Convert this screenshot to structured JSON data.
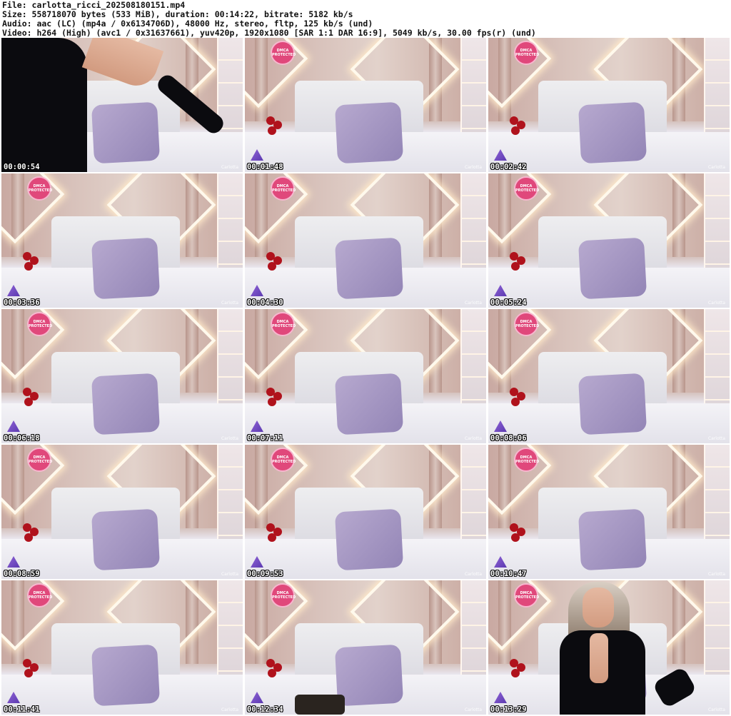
{
  "header": {
    "line1": "File: carlotta_ricci_202508180151.mp4",
    "line2": "Size: 558718070 bytes (533 MiB), duration: 00:14:22, bitrate: 5182 kb/s",
    "line3": "Audio: aac (LC) (mp4a / 0x6134706D), 48000 Hz, stereo, fltp, 125 kb/s (und)",
    "line4": "Video: h264 (High) (avc1 / 0x31637661), yuv420p, 1920x1080 [SAR 1:1 DAR 16:9], 5049 kb/s, 30.00 fps(r) (und)"
  },
  "thumbnails": [
    {
      "timestamp": "00:00:54",
      "scene": "dark-figure-left"
    },
    {
      "timestamp": "00:01:48",
      "scene": "empty-bed"
    },
    {
      "timestamp": "00:02:42",
      "scene": "empty-bed"
    },
    {
      "timestamp": "00:03:36",
      "scene": "empty-bed"
    },
    {
      "timestamp": "00:04:30",
      "scene": "empty-bed"
    },
    {
      "timestamp": "00:05:24",
      "scene": "empty-bed"
    },
    {
      "timestamp": "00:06:18",
      "scene": "empty-bed"
    },
    {
      "timestamp": "00:07:11",
      "scene": "empty-bed"
    },
    {
      "timestamp": "00:08:06",
      "scene": "empty-bed"
    },
    {
      "timestamp": "00:08:59",
      "scene": "empty-bed"
    },
    {
      "timestamp": "00:09:53",
      "scene": "empty-bed"
    },
    {
      "timestamp": "00:10:47",
      "scene": "empty-bed"
    },
    {
      "timestamp": "00:11:41",
      "scene": "empty-bed"
    },
    {
      "timestamp": "00:12:34",
      "scene": "empty-bed-dark-cloth"
    },
    {
      "timestamp": "00:13:29",
      "scene": "person-seated"
    }
  ],
  "badge_text": "DMCA PROTECTED",
  "watermark_text": "Carlotta"
}
